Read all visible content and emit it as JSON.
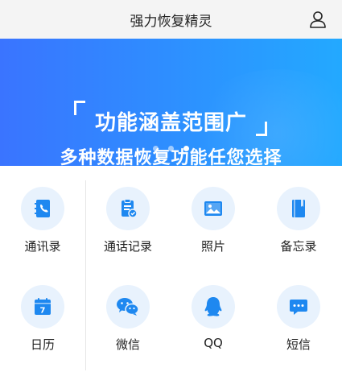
{
  "header": {
    "title": "强力恢复精灵",
    "user_icon": "user-icon"
  },
  "banner": {
    "title": "功能涵盖范围广",
    "subtitle": "多种数据恢复功能任您选择",
    "dots": 3,
    "active_dot": 2
  },
  "grid": {
    "items": [
      {
        "label": "通讯录",
        "icon": "contacts-icon"
      },
      {
        "label": "通话记录",
        "icon": "call-log-icon"
      },
      {
        "label": "照片",
        "icon": "photo-icon"
      },
      {
        "label": "备忘录",
        "icon": "memo-icon"
      },
      {
        "label": "日历",
        "icon": "calendar-icon",
        "icon_text": "7"
      },
      {
        "label": "微信",
        "icon": "wechat-icon"
      },
      {
        "label": "QQ",
        "icon": "qq-icon"
      },
      {
        "label": "短信",
        "icon": "sms-icon"
      }
    ]
  },
  "colors": {
    "accent": "#1e88f0",
    "icon_bg": "#e8f2fd",
    "banner_start": "#3a74ff",
    "banner_end": "#23a9ff"
  }
}
